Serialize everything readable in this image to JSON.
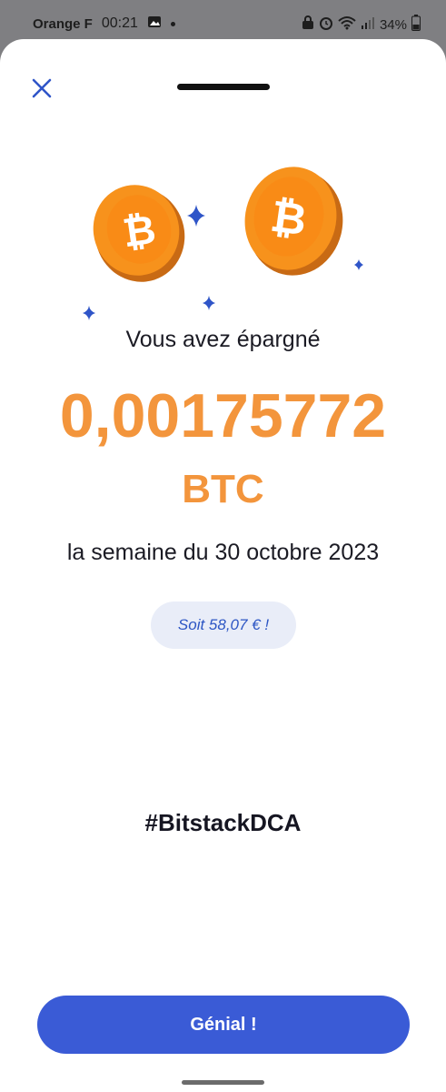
{
  "status_bar": {
    "carrier": "Orange F",
    "time": "00:21",
    "battery": "34%"
  },
  "header": {
    "close_icon": "close-icon"
  },
  "content": {
    "saved_label": "Vous avez épargné",
    "amount": "0,00175772",
    "currency": "BTC",
    "week_label": "la semaine du 30 octobre 2023",
    "fiat_pill": "Soit 58,07 € !",
    "hashtag": "#BitstackDCA"
  },
  "footer": {
    "cta_label": "Génial !"
  },
  "colors": {
    "accent_blue": "#3a5bd6",
    "amount_orange": "#f3953c",
    "pill_bg": "#e9edf8",
    "star_blue": "#2f55c8"
  }
}
